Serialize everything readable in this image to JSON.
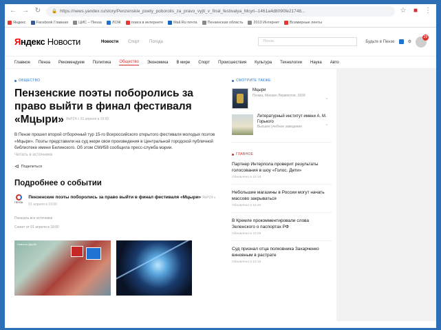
{
  "browser": {
    "url": "https://news.yandex.ru/story/Penzenskie_poety_poborolis_za_pravo_vyjti_v_final_festivalya_Mcyri--1461a4d8090fe21748...",
    "bookmarks": [
      "Яндекс",
      "Facebook Главная",
      "ЦИС – Пенза",
      "ЛОЖ",
      "поиск в интернете",
      "Mail.Ru почта",
      "Пензенская область",
      "2013 Интернет",
      "Всемирные ленты"
    ]
  },
  "header": {
    "logo_ya": "Я",
    "logo_ndex": "ндекс",
    "logo_news": "Новости",
    "services": [
      "Новости",
      "Спорт",
      "Погода"
    ],
    "search_placeholder": "Пенза",
    "location": "Будьте в Пензе",
    "notifications": "29"
  },
  "rubrics": [
    "Главное",
    "Пенза",
    "Рекомендуем",
    "Политика",
    "Общество",
    "Экономика",
    "В мире",
    "Спорт",
    "Происшествия",
    "Культура",
    "Технологии",
    "Наука",
    "Авто"
  ],
  "article": {
    "tag": "Общество",
    "headline": "Пензенские поэты поборолись за право выйти в финал фестиваля «Мцыри»",
    "time": "ЯеPZ4 с 01 апреля в 19:00",
    "lead": "В Пензе прошел второй отборочный тур 15-го Всероссийского открытого фестиваля молодых поэтов «Мцыри». Поэты представили на суд жюри свои произведения в Центральной городской публичной библиотеке имени Белинского. Об этом СМИ58 сообщила пресс-служба мэрии.",
    "source_note": "Читать в источнике",
    "share": "Поделиться",
    "more_title": "Подробнее о событии",
    "story_text": "Пензенские поэты поборолись за право выйти в финал фестиваля «Мцыри»",
    "story_time": "ЯеPZ4 с 01 апреля в 19:00",
    "all_sources": "Показать все источники",
    "updated": "Сюжет от 01 апреля в 18:00",
    "photo_caption": "Новости Дерби"
  },
  "sidebar": {
    "tag1": "Смотрите также",
    "card1_title": "Мцыри",
    "card1_sub": "Поэма, Михаил Лермонтов, 1839",
    "card2_title": "Литературный институт имени А. М. Горького",
    "card2_sub": "Высшее учебное заведение",
    "tag2": "Главное",
    "news": [
      {
        "title": "Партнер Интерпола проверит результаты голосования в шоу «Голос. Дети»",
        "time": "Обновлено в 10:18"
      },
      {
        "title": "Небольшие магазины в России могут начать массово закрываться",
        "time": "Обновлено в 10:30"
      },
      {
        "title": "В Кремле прокомментировали слова Зеленского о паспортах РФ",
        "time": "Обновлено в 10:29"
      },
      {
        "title": "Суд признал отца полковника Захарченко виновным в растрате",
        "time": "Обновлено в 10:16"
      }
    ]
  }
}
